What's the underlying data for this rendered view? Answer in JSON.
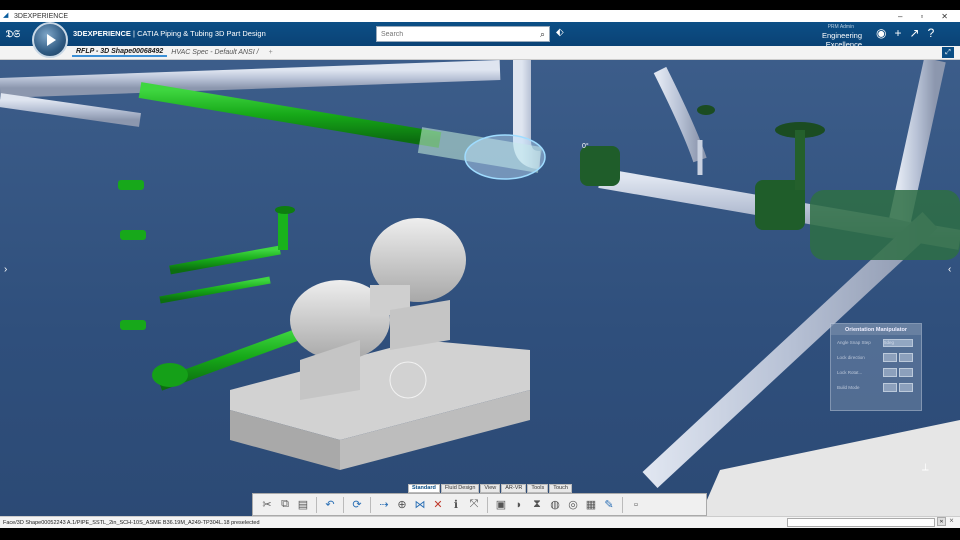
{
  "os": {
    "title": "3DEXPERIENCE",
    "minimize": "–",
    "restore": "▫",
    "close": "✕"
  },
  "header": {
    "brand": "3DEXPERIENCE",
    "app": "CATIA Piping & Tubing 3D Part Design",
    "search_placeholder": "Search",
    "user_role": "PRM Admin",
    "collab_space": "Engineering Excellence"
  },
  "tabs": [
    {
      "label": "RFLP - 3D Shape00068492"
    },
    {
      "label": "HVAC Spec - Default ANSI /"
    },
    {
      "label": "+"
    }
  ],
  "orientation_panel": {
    "title": "Orientation Manipulator",
    "rows": [
      "Angle Snap Step",
      "Lock direction",
      "Lock Rotat...",
      "Build Mode"
    ],
    "angle_value": "5deg"
  },
  "manipulator_value": "0°",
  "action_tabs": [
    "Standard",
    "Fluid Design",
    "View",
    "AR-VR",
    "Tools",
    "Touch"
  ],
  "toolbar": {
    "icons": [
      "cut-icon",
      "copy-icon",
      "paste-icon",
      "undo-icon",
      "update-icon",
      "route-icon",
      "insert-part-icon",
      "connect-icon",
      "delete-icon",
      "info-icon",
      "manipulate-icon",
      "part-icon",
      "elbow-icon",
      "valve-icon",
      "flange-icon",
      "reducer-icon",
      "table-icon",
      "edit-icon",
      "more-icon"
    ]
  },
  "status": {
    "text": "Face/3D Shape00052243 A.1/PIPE_SSTL_2in_SCH-10S_ASME B36.19M_A249-TP304L.18 preselected"
  },
  "colors": {
    "header_blue": "#0b4a80",
    "viewport_blue": "#34567f",
    "pipe_green": "#19b21c",
    "pipe_gray": "#b8c2d6"
  }
}
